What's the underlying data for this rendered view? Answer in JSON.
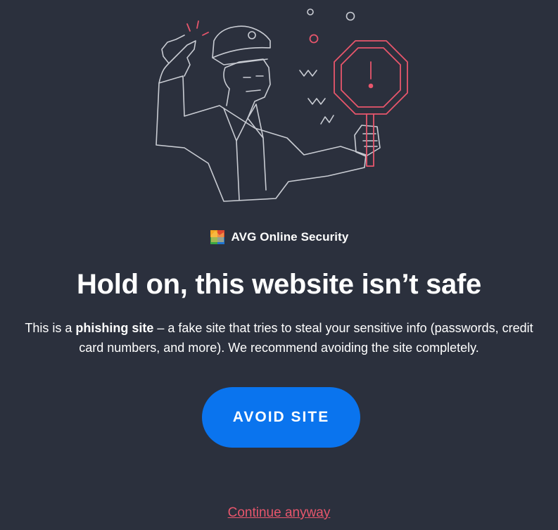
{
  "brand": {
    "logo_icon": "avg-logo-icon",
    "name": "AVG Online Security"
  },
  "warning": {
    "headline": "Hold on, this website isn’t safe",
    "description_prefix": "This is a ",
    "description_bold": "phishing site",
    "description_suffix": " – a fake site that tries to steal your sensitive info (passwords, credit card numbers, and more). We recommend avoiding the site completely."
  },
  "actions": {
    "avoid_label": "AVOID SITE",
    "continue_label": "Continue anyway"
  },
  "illustration": {
    "subject": "police-officer-icon",
    "sign": "stop-sign-warning-icon",
    "sign_symbol": "!"
  },
  "colors": {
    "background": "#2b303d",
    "primary_button": "#0a74ee",
    "danger_accent": "#e8566c",
    "line_art": "#c9ccd3"
  }
}
